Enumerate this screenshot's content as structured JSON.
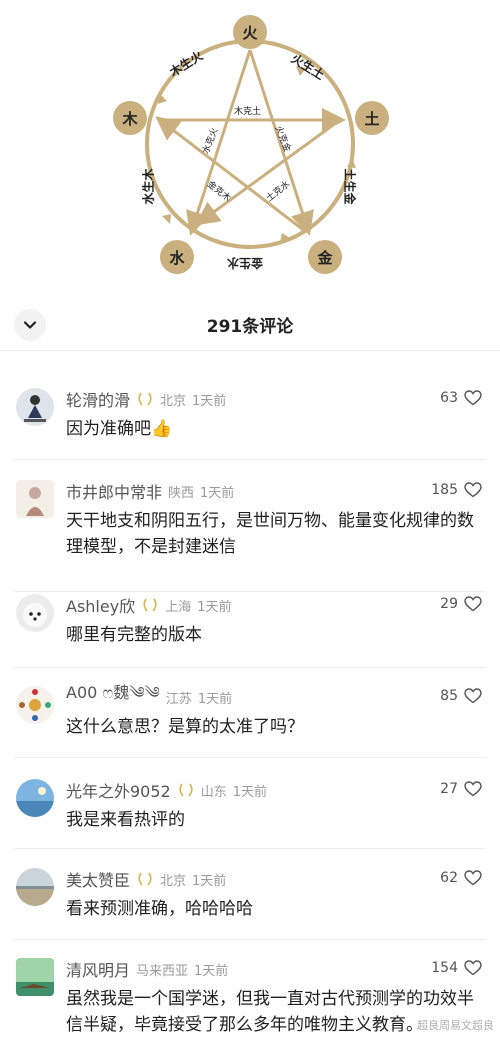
{
  "diagram": {
    "nodes": {
      "fire": "火",
      "earth": "土",
      "metal": "金",
      "water": "水",
      "wood": "木"
    },
    "generating": {
      "wood_fire": "木生火",
      "fire_earth": "火生土",
      "earth_metal": "土生金",
      "metal_water": "金生水",
      "water_wood": "水生木"
    },
    "overcoming": {
      "wood_earth": "木克土",
      "fire_metal": "火克金",
      "water_fire": "水克火",
      "metal_wood": "金克木",
      "earth_water": "土克水"
    },
    "colors": {
      "ring": "#c9b07e",
      "node": "#c9b07e"
    }
  },
  "comments_header": {
    "title": "291条评论"
  },
  "comments": [
    {
      "username": "轮滑的滑",
      "location": "北京",
      "time": "1天前",
      "likes": "63",
      "text": "因为准确吧👍"
    },
    {
      "username": "市井郎中常非",
      "location": "陕西",
      "time": "1天前",
      "likes": "185",
      "text": "天干地支和阴阳五行，是世间万物、能量变化规律的数理模型，不是封建迷信"
    },
    {
      "username": "Ashley欣",
      "location": "上海",
      "time": "1天前",
      "likes": "29",
      "text": "哪里有完整的版本"
    },
    {
      "username": "A00 ෆ魏༄༄",
      "location": "江苏",
      "time": "1天前",
      "likes": "85",
      "text": "这什么意思？是算的太准了吗？"
    },
    {
      "username": "光年之外9052",
      "location": "山东",
      "time": "1天前",
      "likes": "27",
      "text": "我是来看热评的"
    },
    {
      "username": "美太赞臣",
      "location": "北京",
      "time": "1天前",
      "likes": "62",
      "text": "看来预测准确，哈哈哈哈"
    },
    {
      "username": "清风明月",
      "location": "马来西亚",
      "time": "1天前",
      "likes": "154",
      "text": "虽然我是一个国学迷，但我一直对古代预测学的功效半信半疑，毕竟接受了那么多年的唯物主义教育。"
    }
  ],
  "watermark": "超良周易文超良",
  "icons": {
    "collapse": "chevron-down-icon",
    "like": "heart-outline-icon",
    "badge": "laurel-badge-icon"
  }
}
